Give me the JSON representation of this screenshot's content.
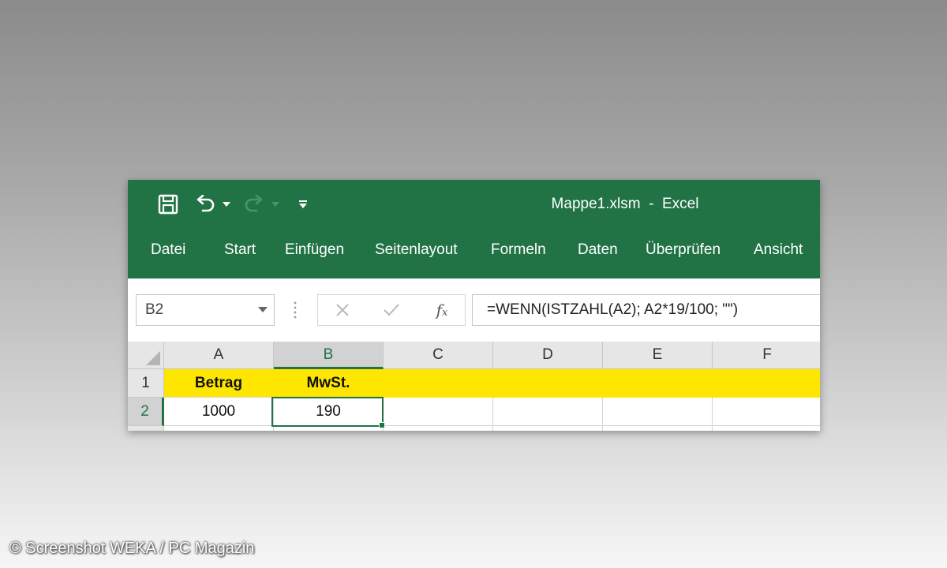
{
  "window": {
    "title": "Mappe1.xlsm  -  Excel",
    "accent_color": "#217346",
    "header_fill_color": "#ffe600"
  },
  "quick_access": {
    "save_icon": "save-icon",
    "undo_icon": "undo-icon",
    "redo_icon": "redo-icon",
    "customize_icon": "customize-qat-icon"
  },
  "ribbon": {
    "tabs": [
      {
        "label": "Datei"
      },
      {
        "label": "Start"
      },
      {
        "label": "Einfügen"
      },
      {
        "label": "Seitenlayout"
      },
      {
        "label": "Formeln"
      },
      {
        "label": "Daten"
      },
      {
        "label": "Überprüfen"
      },
      {
        "label": "Ansicht"
      }
    ]
  },
  "formula_bar": {
    "name_box": "B2",
    "cancel_icon": "cancel-icon",
    "enter_icon": "checkmark-icon",
    "fx_label": "f",
    "fx_sub": "x",
    "formula": "=WENN(ISTZAHL(A2); A2*19/100; \"\")"
  },
  "grid": {
    "columns": [
      "A",
      "B",
      "C",
      "D",
      "E",
      "F"
    ],
    "rows": [
      "1",
      "2"
    ],
    "selected_cell": "B2",
    "cells": {
      "A1": "Betrag",
      "B1": "MwSt.",
      "A2": "1000",
      "B2": "190"
    }
  },
  "watermark": "© Screenshot WEKA / PC Magazin"
}
